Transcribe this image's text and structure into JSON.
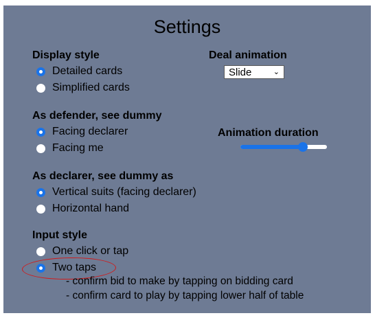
{
  "title": "Settings",
  "display_style": {
    "heading": "Display style",
    "options": [
      "Detailed cards",
      "Simplified cards"
    ],
    "selected": "Detailed cards"
  },
  "deal_animation": {
    "heading": "Deal animation",
    "selected": "Slide"
  },
  "as_defender": {
    "heading": "As defender, see dummy",
    "options": [
      "Facing declarer",
      "Facing me"
    ],
    "selected": "Facing declarer"
  },
  "animation_duration": {
    "heading": "Animation duration",
    "value_fraction": 0.72
  },
  "as_declarer": {
    "heading": "As declarer, see dummy as",
    "options": [
      "Vertical suits (facing declarer)",
      "Horizontal hand"
    ],
    "selected": "Vertical suits (facing declarer)"
  },
  "input_style": {
    "heading": "Input style",
    "options": [
      "One click or tap",
      "Two taps"
    ],
    "selected": "Two taps",
    "notes": [
      "- confirm bid to make by tapping on bidding card",
      "- confirm card to play by tapping lower half of table"
    ]
  },
  "colors": {
    "panel_bg": "#6e7b94",
    "accent": "#1a73e8",
    "annotation": "#d11a1a"
  },
  "icons": {
    "select_chevron": "chevron-down-icon"
  }
}
